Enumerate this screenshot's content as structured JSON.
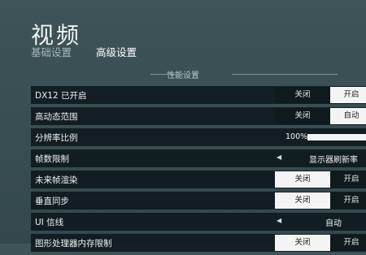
{
  "header": {
    "title": "视频",
    "tabs": [
      {
        "label": "基础设置",
        "active": false
      },
      {
        "label": "高级设置",
        "active": true
      }
    ]
  },
  "section": {
    "title": "性能设置"
  },
  "rows": {
    "dx12": {
      "label": "DX12 已开启",
      "off": "关闭",
      "on": "开启",
      "value": "on"
    },
    "hdr": {
      "label": "高动态范围",
      "off": "关闭",
      "on": "自动",
      "value": "on"
    },
    "resolution_scale": {
      "label": "分辨率比例",
      "value_text": "100%",
      "fraction": 1.0
    },
    "frame_limit": {
      "label": "帧数限制",
      "arrow": "◀",
      "value": "显示器刷新率"
    },
    "future_frame": {
      "label": "未来帧渲染",
      "off": "关闭",
      "on": "开启",
      "value": "off"
    },
    "vsync": {
      "label": "垂直同步",
      "off": "关闭",
      "on": "开启",
      "value": "off"
    },
    "ui_gamma": {
      "label": "UI 信线",
      "arrow": "◀",
      "value": "自动"
    },
    "gpu_mem_limit": {
      "label": "图形处理器内存限制",
      "off": "关闭",
      "on": "开启",
      "value": "off"
    }
  },
  "colors": {
    "row_bg": "#0f1a1d",
    "selected": "#f4f4f4",
    "background": "#3a4f54"
  }
}
